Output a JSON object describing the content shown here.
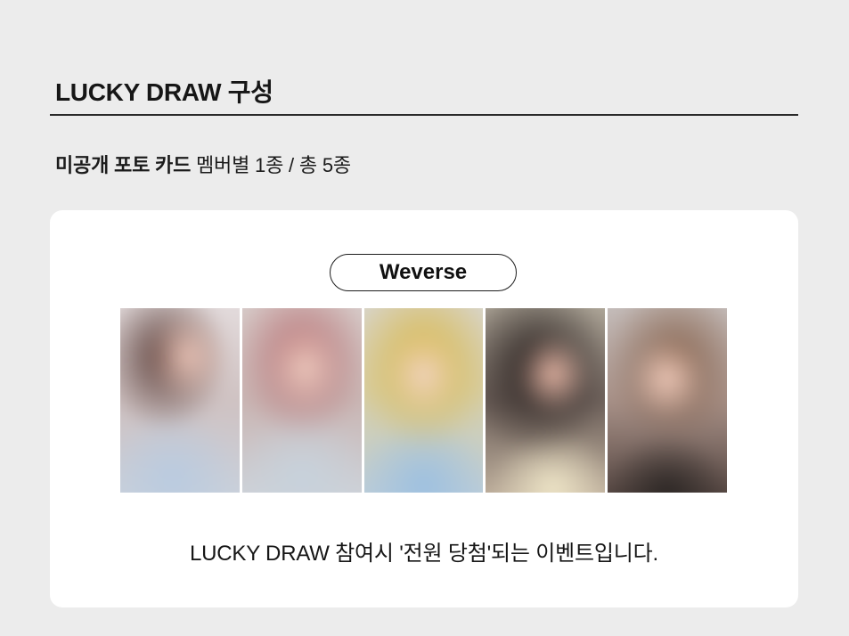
{
  "section": {
    "title": "LUCKY DRAW 구성"
  },
  "subtitle": {
    "bold": "미공개 포토 카드",
    "normal": " 멤버별 1종 / 총 5종"
  },
  "card": {
    "platform_label": "Weverse",
    "photos": [
      "photocard-1",
      "photocard-2",
      "photocard-3",
      "photocard-4",
      "photocard-5"
    ],
    "caption": "LUCKY DRAW 참여시 '전원 당첨'되는 이벤트입니다."
  }
}
